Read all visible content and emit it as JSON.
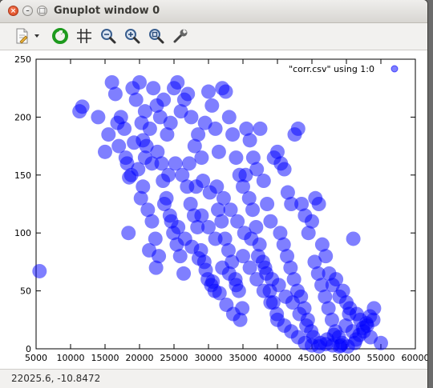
{
  "window": {
    "title": "Gnuplot window 0",
    "close_glyph": "×",
    "minimize_glyph": "–",
    "maximize_glyph": "□"
  },
  "toolbar": {
    "items": [
      {
        "name": "copy-to-clipboard-icon"
      },
      {
        "name": "dropdown-arrow-icon"
      },
      {
        "name": "replot-icon"
      },
      {
        "name": "grid-icon"
      },
      {
        "name": "zoom-previous-icon"
      },
      {
        "name": "zoom-next-icon"
      },
      {
        "name": "autoscale-icon"
      },
      {
        "name": "configure-icon"
      }
    ]
  },
  "status": {
    "coordinates": "22025.6, -10.8472"
  },
  "chart_data": {
    "type": "scatter",
    "title": "",
    "xlabel": "",
    "ylabel": "",
    "xlim": [
      5000,
      60000
    ],
    "ylim": [
      0,
      250
    ],
    "xticks": [
      "5000",
      "10000",
      "15000",
      "20000",
      "25000",
      "30000",
      "35000",
      "40000",
      "45000",
      "50000",
      "55000",
      "60000"
    ],
    "yticks": [
      "0",
      "50",
      "100",
      "150",
      "200",
      "250"
    ],
    "grid": false,
    "legend": {
      "position": "top-right"
    },
    "colors": {
      "point_fill": "#0000ff",
      "point_opacity": 0.5
    },
    "series": [
      {
        "name": "\"corr.csv\" using 1:0",
        "points": [
          [
            5500,
            67
          ],
          [
            11300,
            205
          ],
          [
            11700,
            209
          ],
          [
            16000,
            230
          ],
          [
            16500,
            220
          ],
          [
            17300,
            200
          ],
          [
            17800,
            190
          ],
          [
            18200,
            160
          ],
          [
            18500,
            148
          ],
          [
            19000,
            225
          ],
          [
            19500,
            215
          ],
          [
            20000,
            230
          ],
          [
            20300,
            195
          ],
          [
            20500,
            180
          ],
          [
            20800,
            205
          ],
          [
            21000,
            175
          ],
          [
            21500,
            190
          ],
          [
            22000,
            225
          ],
          [
            22500,
            210
          ],
          [
            23000,
            200
          ],
          [
            23500,
            215
          ],
          [
            24000,
            185
          ],
          [
            24500,
            195
          ],
          [
            25000,
            225
          ],
          [
            25500,
            230
          ],
          [
            26000,
            205
          ],
          [
            26500,
            215
          ],
          [
            27000,
            220
          ],
          [
            27500,
            200
          ],
          [
            28000,
            175
          ],
          [
            28500,
            185
          ],
          [
            29000,
            165
          ],
          [
            29500,
            195
          ],
          [
            30000,
            222
          ],
          [
            30500,
            210
          ],
          [
            31000,
            190
          ],
          [
            31500,
            170
          ],
          [
            32000,
            225
          ],
          [
            32500,
            222
          ],
          [
            33000,
            200
          ],
          [
            33500,
            185
          ],
          [
            34000,
            165
          ],
          [
            34500,
            150
          ],
          [
            35000,
            140
          ],
          [
            35500,
            190
          ],
          [
            36000,
            180
          ],
          [
            36500,
            165
          ],
          [
            37000,
            155
          ],
          [
            37500,
            190
          ],
          [
            38000,
            145
          ],
          [
            38500,
            125
          ],
          [
            39000,
            110
          ],
          [
            39500,
            165
          ],
          [
            40000,
            170
          ],
          [
            40500,
            160
          ],
          [
            41000,
            155
          ],
          [
            41500,
            135
          ],
          [
            42000,
            125
          ],
          [
            42500,
            185
          ],
          [
            43000,
            190
          ],
          [
            43500,
            125
          ],
          [
            44000,
            115
          ],
          [
            44500,
            100
          ],
          [
            45000,
            110
          ],
          [
            45500,
            130
          ],
          [
            46000,
            125
          ],
          [
            46500,
            90
          ],
          [
            47000,
            80
          ],
          [
            47500,
            65
          ],
          [
            48000,
            55
          ],
          [
            48500,
            60
          ],
          [
            49000,
            45
          ],
          [
            49500,
            50
          ],
          [
            50000,
            40
          ],
          [
            50500,
            35
          ],
          [
            51000,
            95
          ],
          [
            51500,
            30
          ],
          [
            52000,
            25
          ],
          [
            52500,
            15
          ],
          [
            53000,
            20
          ],
          [
            53500,
            10
          ],
          [
            54000,
            35
          ],
          [
            55000,
            5
          ],
          [
            14000,
            200
          ],
          [
            15500,
            185
          ],
          [
            17000,
            175
          ],
          [
            18800,
            150
          ],
          [
            19800,
            155
          ],
          [
            20500,
            140
          ],
          [
            21200,
            120
          ],
          [
            21800,
            110
          ],
          [
            22300,
            95
          ],
          [
            22800,
            80
          ],
          [
            23400,
            145
          ],
          [
            23900,
            130
          ],
          [
            24400,
            115
          ],
          [
            24900,
            100
          ],
          [
            25400,
            90
          ],
          [
            25900,
            80
          ],
          [
            26400,
            65
          ],
          [
            26900,
            140
          ],
          [
            27400,
            125
          ],
          [
            27900,
            115
          ],
          [
            28400,
            105
          ],
          [
            28900,
            85
          ],
          [
            29400,
            75
          ],
          [
            29900,
            60
          ],
          [
            30400,
            55
          ],
          [
            30900,
            50
          ],
          [
            31400,
            120
          ],
          [
            31900,
            110
          ],
          [
            32400,
            95
          ],
          [
            32900,
            85
          ],
          [
            33400,
            75
          ],
          [
            33900,
            60
          ],
          [
            34400,
            50
          ],
          [
            34900,
            35
          ],
          [
            35400,
            150
          ],
          [
            35900,
            130
          ],
          [
            36400,
            120
          ],
          [
            36900,
            105
          ],
          [
            37400,
            90
          ],
          [
            37900,
            75
          ],
          [
            38400,
            65
          ],
          [
            38900,
            50
          ],
          [
            39400,
            40
          ],
          [
            39900,
            30
          ],
          [
            40400,
            100
          ],
          [
            40900,
            90
          ],
          [
            41400,
            80
          ],
          [
            41900,
            70
          ],
          [
            42400,
            60
          ],
          [
            42900,
            50
          ],
          [
            43400,
            45
          ],
          [
            43900,
            35
          ],
          [
            44400,
            25
          ],
          [
            44900,
            15
          ],
          [
            45400,
            75
          ],
          [
            45900,
            65
          ],
          [
            46400,
            55
          ],
          [
            46900,
            45
          ],
          [
            47400,
            35
          ],
          [
            47900,
            25
          ],
          [
            48400,
            15
          ],
          [
            48900,
            10
          ],
          [
            49400,
            5
          ],
          [
            49900,
            20
          ],
          [
            50400,
            30
          ],
          [
            50900,
            15
          ],
          [
            51400,
            8
          ],
          [
            51900,
            12
          ],
          [
            52400,
            18
          ],
          [
            52900,
            22
          ],
          [
            53400,
            28
          ],
          [
            53900,
            25
          ],
          [
            15000,
            170
          ],
          [
            16800,
            195
          ],
          [
            18000,
            165
          ],
          [
            19200,
            178
          ],
          [
            20800,
            165
          ],
          [
            21800,
            160
          ],
          [
            22600,
            170
          ],
          [
            23200,
            160
          ],
          [
            24200,
            150
          ],
          [
            25200,
            160
          ],
          [
            26200,
            150
          ],
          [
            27200,
            160
          ],
          [
            28200,
            140
          ],
          [
            29200,
            145
          ],
          [
            30200,
            135
          ],
          [
            31200,
            140
          ],
          [
            32200,
            130
          ],
          [
            33200,
            120
          ],
          [
            34200,
            110
          ],
          [
            35200,
            100
          ],
          [
            36200,
            95
          ],
          [
            37200,
            80
          ],
          [
            38200,
            70
          ],
          [
            39200,
            60
          ],
          [
            40200,
            55
          ],
          [
            41200,
            45
          ],
          [
            42200,
            40
          ],
          [
            43200,
            30
          ],
          [
            44200,
            20
          ],
          [
            45200,
            10
          ],
          [
            46200,
            5
          ],
          [
            47200,
            8
          ],
          [
            48200,
            12
          ],
          [
            49200,
            3
          ],
          [
            50200,
            2
          ],
          [
            51200,
            5
          ],
          [
            18400,
            100
          ],
          [
            20200,
            130
          ],
          [
            21400,
            85
          ],
          [
            22400,
            70
          ],
          [
            23600,
            125
          ],
          [
            24600,
            110
          ],
          [
            25600,
            105
          ],
          [
            26600,
            95
          ],
          [
            27600,
            88
          ],
          [
            28600,
            78
          ],
          [
            29600,
            68
          ],
          [
            30600,
            58
          ],
          [
            31600,
            48
          ],
          [
            32600,
            38
          ],
          [
            33600,
            30
          ],
          [
            34600,
            25
          ],
          [
            29000,
            115
          ],
          [
            30000,
            105
          ],
          [
            31000,
            95
          ],
          [
            32000,
            70
          ],
          [
            33000,
            65
          ],
          [
            34000,
            55
          ],
          [
            35000,
            80
          ],
          [
            36000,
            70
          ],
          [
            37000,
            60
          ],
          [
            38000,
            50
          ],
          [
            39000,
            40
          ],
          [
            40000,
            25
          ],
          [
            41000,
            20
          ],
          [
            42000,
            15
          ],
          [
            43000,
            10
          ],
          [
            44000,
            5
          ],
          [
            45000,
            3
          ],
          [
            46000,
            2
          ],
          [
            47000,
            4
          ],
          [
            48000,
            3
          ],
          [
            49000,
            2
          ]
        ]
      }
    ]
  }
}
